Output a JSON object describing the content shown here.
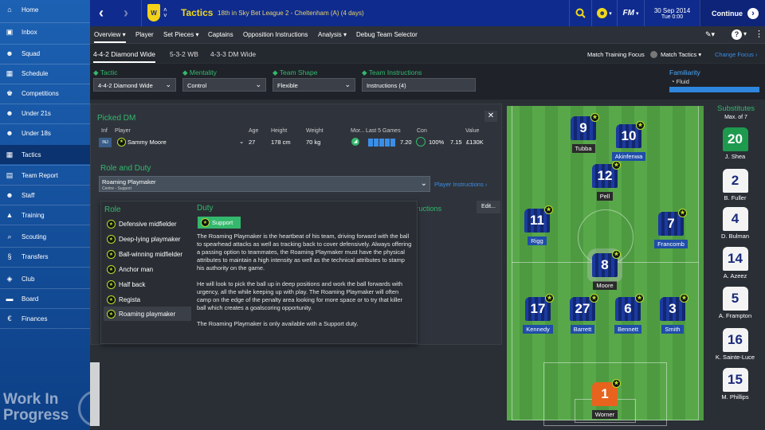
{
  "sidebar": {
    "items": [
      {
        "label": "Home",
        "icon": "home-icon",
        "glyph": "⌂"
      },
      {
        "label": "Inbox",
        "icon": "inbox-icon",
        "glyph": "▣"
      },
      {
        "label": "Squad",
        "icon": "squad-icon",
        "glyph": "☻"
      },
      {
        "label": "Schedule",
        "icon": "schedule-icon",
        "glyph": "▦"
      },
      {
        "label": "Competitions",
        "icon": "trophy-icon",
        "glyph": "♚"
      },
      {
        "label": "Under 21s",
        "icon": "under21-icon",
        "glyph": "☻"
      },
      {
        "label": "Under 18s",
        "icon": "under18-icon",
        "glyph": "☻"
      },
      {
        "label": "Tactics",
        "icon": "tactics-icon",
        "glyph": "▦"
      },
      {
        "label": "Team Report",
        "icon": "report-icon",
        "glyph": "▤"
      },
      {
        "label": "Staff",
        "icon": "staff-icon",
        "glyph": "☻"
      },
      {
        "label": "Training",
        "icon": "training-icon",
        "glyph": "▲"
      },
      {
        "label": "Scouting",
        "icon": "scouting-icon",
        "glyph": "⌕"
      },
      {
        "label": "Transfers",
        "icon": "transfers-icon",
        "glyph": "§"
      },
      {
        "label": "Club",
        "icon": "club-icon",
        "glyph": "◈"
      },
      {
        "label": "Board",
        "icon": "board-icon",
        "glyph": "▬"
      },
      {
        "label": "Finances",
        "icon": "finances-icon",
        "glyph": "€"
      }
    ],
    "watermark": "Work In\nProgress"
  },
  "topbar": {
    "title": "Tactics",
    "subtitle": "18th in Sky Bet League 2 - Cheltenham (A) (4 days)",
    "logo": "FM",
    "date": "30 Sep 2014",
    "time": "Tue 0:00",
    "continue": "Continue"
  },
  "tabs": [
    "Overview",
    "Player",
    "Set Pieces",
    "Captains",
    "Opposition Instructions",
    "Analysis",
    "Debug Team Selector"
  ],
  "formations": [
    "4-4-2 Diamond Wide",
    "5-3-2 WB",
    "4-3-3 DM Wide"
  ],
  "match_training_focus": "Match Training Focus",
  "match_tactics": "Match Tactics",
  "change_focus": "Change Focus",
  "settings": {
    "tactic": {
      "label": "Tactic",
      "value": "4-4-2 Diamond Wide"
    },
    "mentality": {
      "label": "Mentality",
      "value": "Control"
    },
    "team_shape": {
      "label": "Team Shape",
      "value": "Flexible"
    },
    "team_instructions": {
      "label": "Team Instructions",
      "value": "Instructions (4)"
    },
    "familiarity": {
      "label": "Familiarity",
      "value": "Fluid"
    }
  },
  "picked": {
    "title": "Picked DM",
    "headers": {
      "inf": "Inf",
      "player": "Player",
      "age": "Age",
      "height": "Height",
      "weight": "Weight",
      "mor": "Mor...",
      "last5": "Last 5 Games",
      "con": "Con",
      "value": "Value"
    },
    "row": {
      "inf": "INJ",
      "player": "Sammy Moore",
      "age": "27",
      "height": "178 cm",
      "weight": "70 kg",
      "rating": "7.20",
      "con": "100%",
      "avg": "7.15",
      "value": "£130K"
    },
    "role_duty_title": "Role and Duty",
    "role_value": "Roaming Playmaker",
    "role_sub": "Centre - Support",
    "player_instructions": "Player Instructions",
    "instructions_tail": "tructions",
    "edit": "Edit..."
  },
  "roles": {
    "title": "Role",
    "items": [
      "Defensive midfielder",
      "Deep-lying playmaker",
      "Ball-winning midfielder",
      "Anchor man",
      "Half back",
      "Regista",
      "Roaming playmaker"
    ]
  },
  "duty": {
    "title": "Duty",
    "value": "Support",
    "p1": "The Roaming Playmaker is the heartbeat of his team, driving forward with the ball to spearhead attacks as well as tracking back to cover defensively. Always offering a passing option to teammates, the Roaming Playmaker must have the physical attributes to maintain a high intensity as well as the technical attributes to stamp his authority on the game.",
    "p2": "He will look to pick the ball up in deep positions and work the ball forwards with urgency, all the while keeping up with play. The Roaming Playmaker will often camp on the edge of the penalty area looking for more space or to try that killer ball which creates a goalscoring opportunity.",
    "p3": "The Roaming Playmaker is only available with a Support duty."
  },
  "pitch_players": [
    {
      "num": "9",
      "name": "Tubba",
      "kit": "blue",
      "tag": "d"
    },
    {
      "num": "10",
      "name": "Akinfenwa",
      "kit": "blue",
      "tag": "b"
    },
    {
      "num": "12",
      "name": "Pell",
      "kit": "blue",
      "tag": "d"
    },
    {
      "num": "11",
      "name": "Rigg",
      "kit": "blue",
      "tag": "b"
    },
    {
      "num": "7",
      "name": "Francomb",
      "kit": "blue",
      "tag": "b"
    },
    {
      "num": "8",
      "name": "Moore",
      "kit": "blue",
      "tag": "d"
    },
    {
      "num": "17",
      "name": "Kennedy",
      "kit": "blue",
      "tag": "b"
    },
    {
      "num": "27",
      "name": "Barrett",
      "kit": "blue",
      "tag": "b"
    },
    {
      "num": "6",
      "name": "Bennett",
      "kit": "blue",
      "tag": "b"
    },
    {
      "num": "3",
      "name": "Smith",
      "kit": "blue",
      "tag": "b"
    },
    {
      "num": "1",
      "name": "Worner",
      "kit": "orange",
      "tag": "d"
    }
  ],
  "subs": {
    "title": "Substitutes",
    "max": "Max. of 7",
    "players": [
      {
        "num": "20",
        "name": "J. Shea",
        "kit": "green"
      },
      {
        "num": "2",
        "name": "B. Fuller",
        "kit": "white"
      },
      {
        "num": "4",
        "name": "D. Bulman",
        "kit": "white"
      },
      {
        "num": "14",
        "name": "A. Azeez",
        "kit": "white"
      },
      {
        "num": "5",
        "name": "A. Frampton",
        "kit": "white"
      },
      {
        "num": "16",
        "name": "K. Sainte-Luce",
        "kit": "white"
      },
      {
        "num": "15",
        "name": "M. Phillips",
        "kit": "white"
      }
    ]
  }
}
